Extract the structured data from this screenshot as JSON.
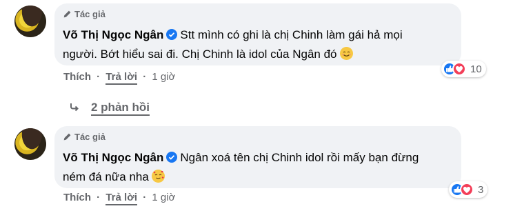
{
  "comments": [
    {
      "badge": "Tác giả",
      "author": "Võ Thị Ngọc Ngân",
      "line1": "Stt mình có ghi là chị Chinh làm gái hả mọi",
      "line2": "người. Bớt hiểu sai đi. Chị Chinh là idol của Ngân đó",
      "reaction_count": "10",
      "like_label": "Thích",
      "reply_label": "Trả lời",
      "dot": "·",
      "time": "1 giờ"
    },
    {
      "badge": "Tác giả",
      "author": "Võ Thị Ngọc Ngân",
      "line1": "Ngân xoá tên chị Chinh idol rồi mấy bạn đừng",
      "line2": "ném đá nữa nha",
      "reaction_count": "3",
      "like_label": "Thích",
      "reply_label": "Trả lời",
      "dot": "·",
      "time": "1 giờ"
    }
  ],
  "view_replies": "2 phản hồi",
  "colors": {
    "bubble": "#f0f2f5",
    "like": "#1877f2",
    "love": "#f33e58",
    "verified": "#1877f2",
    "meta": "#65676b"
  },
  "icons": [
    "pencil-icon",
    "verified-badge-icon",
    "like-reaction-icon",
    "love-reaction-icon",
    "reply-arrow-icon",
    "smile-emoji-icon",
    "heart-face-emoji-icon"
  ]
}
